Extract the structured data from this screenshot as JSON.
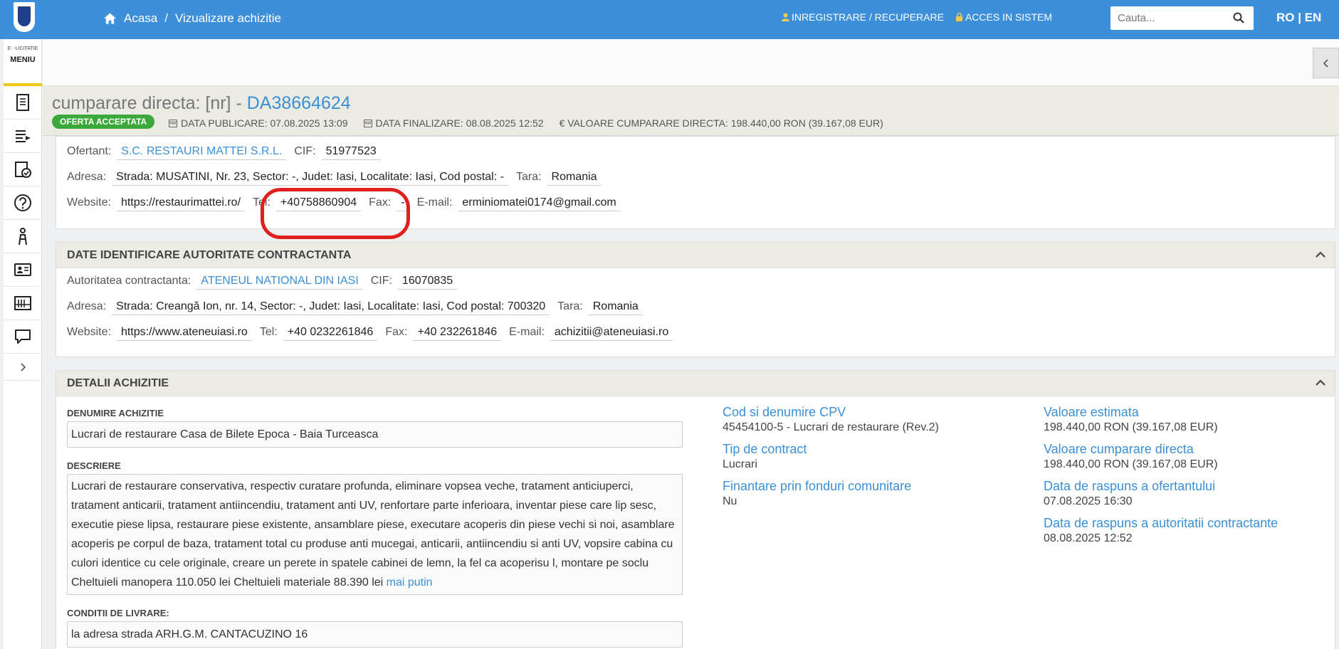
{
  "header": {
    "breadcrumb_home": "Acasa",
    "breadcrumb_sep": "/",
    "breadcrumb_current": "Vizualizare achizitie",
    "register_link": "INREGISTRARE / RECUPERARE",
    "login_link": "ACCES IN SISTEM",
    "search_placeholder": "Cauta...",
    "lang": "RO | EN"
  },
  "sidebar": {
    "small_label": "E - LICITATIE",
    "menu_label": "MENIU",
    "icons": [
      "document-icon",
      "list-export-icon",
      "checklist-icon",
      "help-icon",
      "person-icon",
      "id-card-icon",
      "calendar-board-icon",
      "chat-icon"
    ]
  },
  "title": {
    "prefix": "cumparare directa: [nr] - ",
    "code": "DA38664624",
    "status": "OFERTA ACCEPTATA",
    "publish": "DATA PUBLICARE: 07.08.2025 13:09",
    "final": "DATA FINALIZARE: 08.08.2025 12:52",
    "value": "€ VALOARE CUMPARARE DIRECTA: 198.440,00  RON (39.167,08  EUR)"
  },
  "ofertant": {
    "label_ofertant": "Ofertant:",
    "name": "S.C. RESTAURI MATTEI S.R.L.",
    "label_cif": "CIF:",
    "cif": "51977523",
    "label_adresa": "Adresa:",
    "adresa": "Strada: MUSATINI, Nr. 23, Sector: -, Judet: Iasi, Localitate: Iasi, Cod postal: -",
    "label_tara": "Tara:",
    "tara": "Romania",
    "label_website": "Website:",
    "website": "https://restaurimattei.ro/",
    "label_tel": "Tel:",
    "tel": "+40758860904",
    "label_fax": "Fax:",
    "fax": "-",
    "label_email": "E-mail:",
    "email": "erminiomatei0174@gmail.com"
  },
  "autoritate": {
    "header": "DATE IDENTIFICARE AUTORITATE CONTRACTANTA",
    "label_name": "Autoritatea contractanta:",
    "name": "ATENEUL NATIONAL DIN IASI",
    "label_cif": "CIF:",
    "cif": "16070835",
    "label_adresa": "Adresa:",
    "adresa": "Strada: Creangă Ion, nr. 14, Sector: -, Judet: Iasi, Localitate: Iasi, Cod postal: 700320",
    "label_tara": "Tara:",
    "tara": "Romania",
    "label_website": "Website:",
    "website": "https://www.ateneuiasi.ro",
    "label_tel": "Tel:",
    "tel": "+40 0232261846",
    "label_fax": "Fax:",
    "fax": "+40 232261846",
    "label_email": "E-mail:",
    "email": "achizitii@ateneuiasi.ro"
  },
  "detalii": {
    "header": "DETALII ACHIZITIE",
    "denumire_label": "DENUMIRE ACHIZITIE",
    "denumire": "Lucrari de restaurare Casa de Bilete Epoca - Baia Turceasca",
    "descriere_label": "DESCRIERE",
    "descriere": "Lucrari de restaurare conservativa, respectiv curatare profunda, eliminare vopsea veche, tratament anticiuperci, tratament anticarii, tratament antiincendiu, tratament anti UV, renfortare parte inferioara, inventar piese care lip sesc, executie piese lipsa, restaurare piese existente, ansamblare piese, executare acoperis din piese vechi si noi, asamblare acoperis pe corpul de baza, tratament total cu produse anti mucegai, anticarii, antiincendiu si anti UV, vopsire cabina cu culori identice cu cele originale, creare un perete in spatele cabinei de lemn, la fel ca acoperisu l, montare pe soclu Cheltuieli manopera 110.050 lei Cheltuieli materiale 88.390 lei ",
    "mai_putin": "mai putin",
    "conditii_label": "CONDITII DE LIVRARE:",
    "conditii": "la adresa strada ARH.G.M. CANTACUZINO 16",
    "cpv_h": "Cod si denumire CPV",
    "cpv_v": "45454100-5 - Lucrari de restaurare (Rev.2)",
    "tip_h": "Tip de contract",
    "tip_v": "Lucrari",
    "fin_h": "Finantare prin fonduri comunitare",
    "fin_v": "Nu",
    "val_est_h": "Valoare estimata",
    "val_est_v": "198.440,00  RON (39.167,08  EUR)",
    "val_cd_h": "Valoare cumparare directa",
    "val_cd_v": "198.440,00  RON (39.167,08  EUR)",
    "rasp_of_h": "Data de raspuns a ofertantului",
    "rasp_of_v": "07.08.2025 16:30",
    "rasp_ac_h": "Data de raspuns a autoritatii contractante",
    "rasp_ac_v": "08.08.2025 12:52"
  },
  "colors": {
    "topbar": "#3d8fd9",
    "link": "#3a8fd6",
    "status_green": "#3aa83a",
    "highlight_red": "#e0201c"
  }
}
